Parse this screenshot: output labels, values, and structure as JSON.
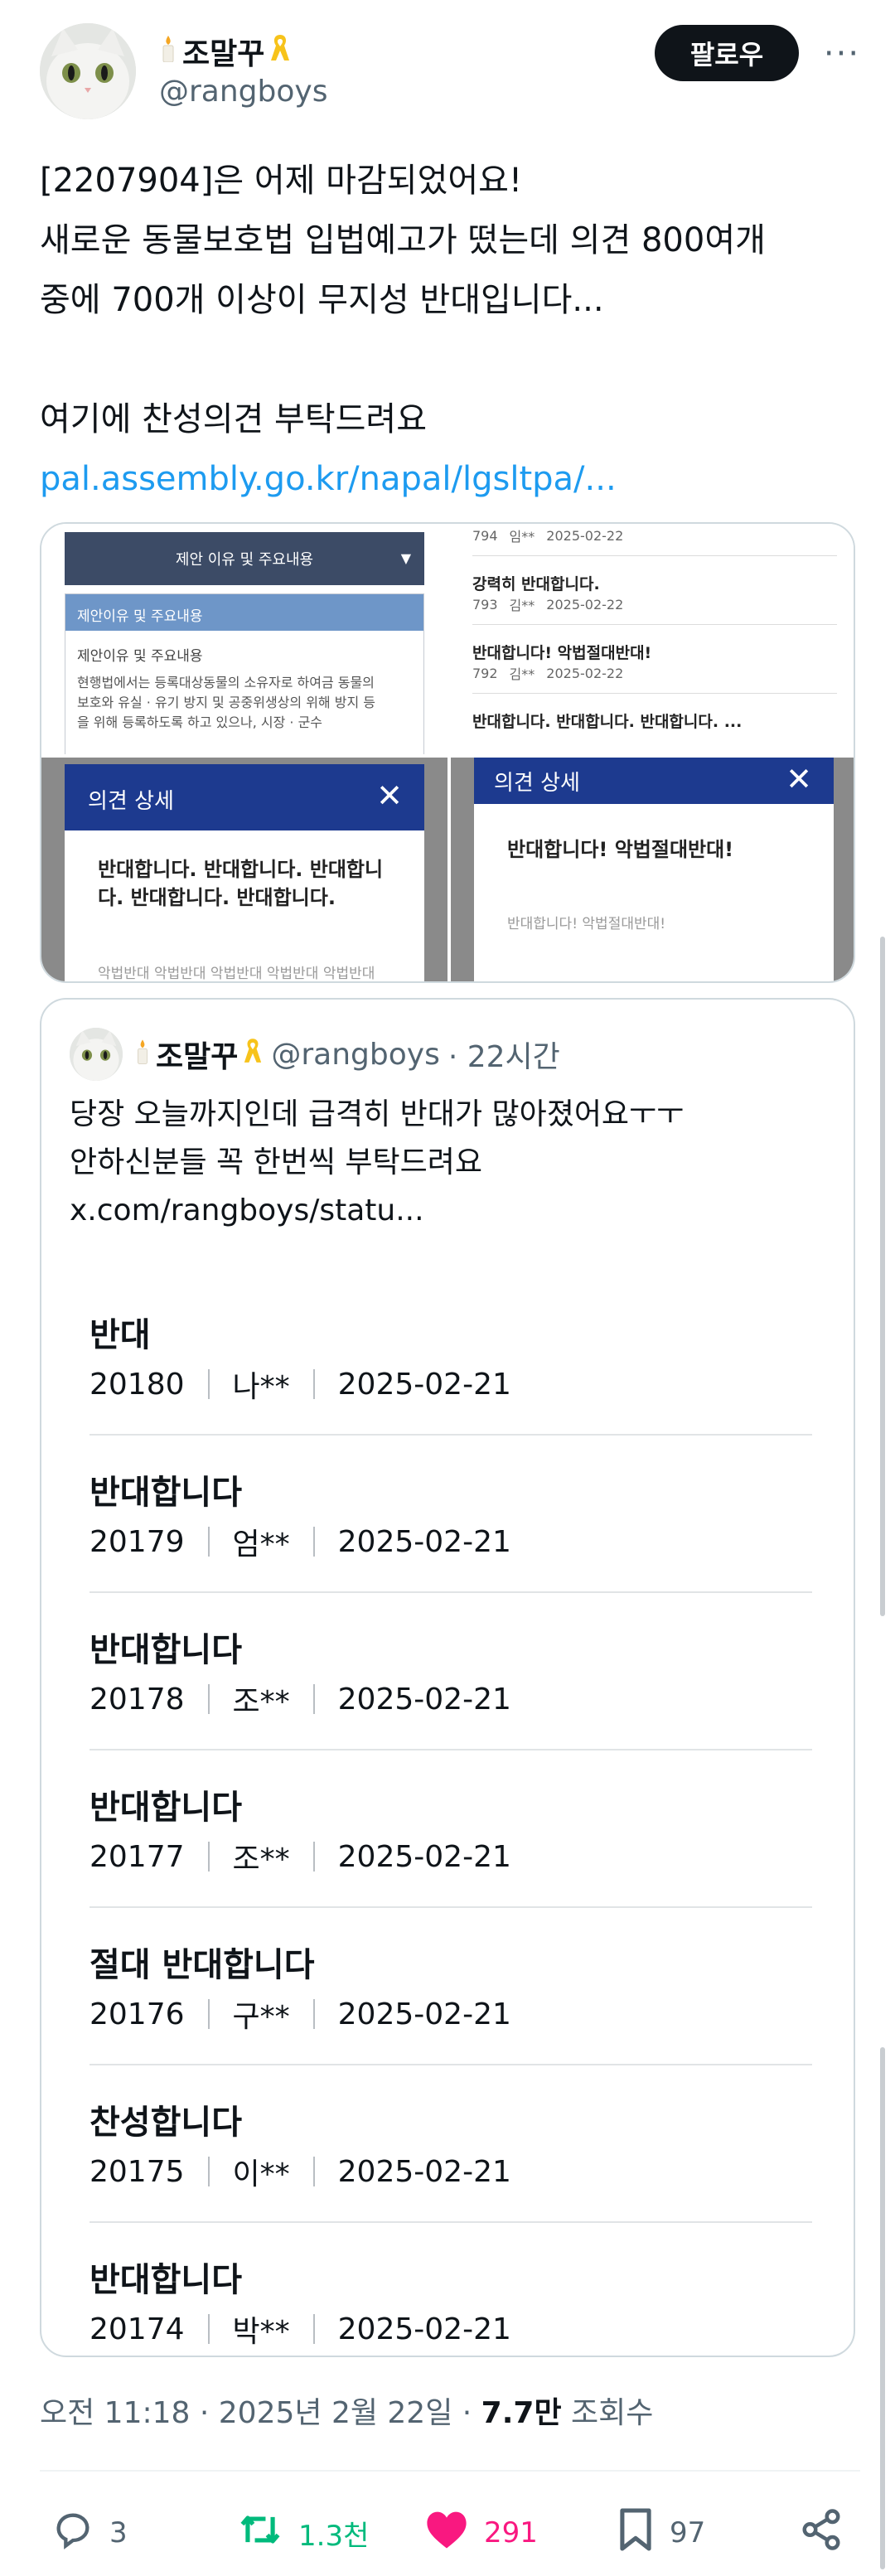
{
  "colors": {
    "accent": "#1d9bf0",
    "retweet": "#00ba7c",
    "like": "#f91880",
    "text": "#0f1419",
    "muted": "#536471"
  },
  "author": {
    "name": "조말꾸",
    "handle": "@rangboys",
    "badges": [
      "candle-icon",
      "yellow-ribbon-icon"
    ]
  },
  "header": {
    "follow_label": "팔로우",
    "more_label": "···"
  },
  "tweet": {
    "lines": [
      "[2207904]은 어제 마감되었어요!",
      "새로운 동물보호법 입법예고가 떴는데 의견 800여개",
      "중에 700개 이상이 무지성 반대입니다...",
      "",
      "여기에 찬성의견 부탁드려요"
    ],
    "link": "pal.assembly.go.kr/napal/lgsltpa/..."
  },
  "media": {
    "top_left": {
      "bar_label": "제안 이유 및 주요내용",
      "box_heading": "제안이유 및 주요내용",
      "box_sub": "제안이유 및 주요내용",
      "box_body_1": "현행법에서는 등록대상동물의 소유자로 하여금 동물의",
      "box_body_2": "보호와 유실 · 유기 방지 및 공중위생상의 위해 방지 등",
      "box_body_3": "을 위해 등록하도록 하고 있으나, 시장 · 군수"
    },
    "top_right": {
      "items": [
        {
          "title": "",
          "num": "794",
          "user": "임**",
          "date": "2025-02-22"
        },
        {
          "title": "강력히 반대합니다.",
          "num": "793",
          "user": "김**",
          "date": "2025-02-22"
        },
        {
          "title": "반대합니다! 악법절대반대!",
          "num": "792",
          "user": "김**",
          "date": "2025-02-22"
        },
        {
          "title": "반대합니다. 반대합니다. 반대합니다. ...",
          "num": "",
          "user": "",
          "date": ""
        }
      ]
    },
    "bottom_left": {
      "title": "의견 상세",
      "text_1": "반대합니다. 반대합니다. 반대합니",
      "text_2": "다. 반대합니다. 반대합니다.",
      "faint": "악법반대 악법반대 악법반대 악법반대 악법반대"
    },
    "bottom_right": {
      "title": "의견 상세",
      "text": "반대합니다! 악법절대반대!",
      "faint": "반대합니다! 악법절대반대!"
    }
  },
  "quote": {
    "name": "조말꾸",
    "handle": "@rangboys",
    "time": "· 22시간",
    "lines": [
      "당장 오늘까지인데 급격히 반대가 많아졌어요ㅜㅜ",
      "안하신분들 꼭 한번씩 부탁드려요",
      "x.com/rangboys/statu..."
    ],
    "items": [
      {
        "title": "반대",
        "num": "20180",
        "user": "나**",
        "date": "2025-02-21"
      },
      {
        "title": "반대합니다",
        "num": "20179",
        "user": "엄**",
        "date": "2025-02-21"
      },
      {
        "title": "반대합니다",
        "num": "20178",
        "user": "조**",
        "date": "2025-02-21"
      },
      {
        "title": "반대합니다",
        "num": "20177",
        "user": "조**",
        "date": "2025-02-21"
      },
      {
        "title": "절대 반대합니다",
        "num": "20176",
        "user": "구**",
        "date": "2025-02-21"
      },
      {
        "title": "찬성합니다",
        "num": "20175",
        "user": "이**",
        "date": "2025-02-21"
      },
      {
        "title": "반대합니다",
        "num": "20174",
        "user": "박**",
        "date": "2025-02-21"
      }
    ]
  },
  "meta": {
    "time": "오전 11:18 · 2025년 2월 22일 · ",
    "views": "7.7만",
    "views_label": " 조회수"
  },
  "actions": {
    "replies": "3",
    "retweets": "1.3천",
    "likes": "291",
    "bookmarks": "97"
  }
}
